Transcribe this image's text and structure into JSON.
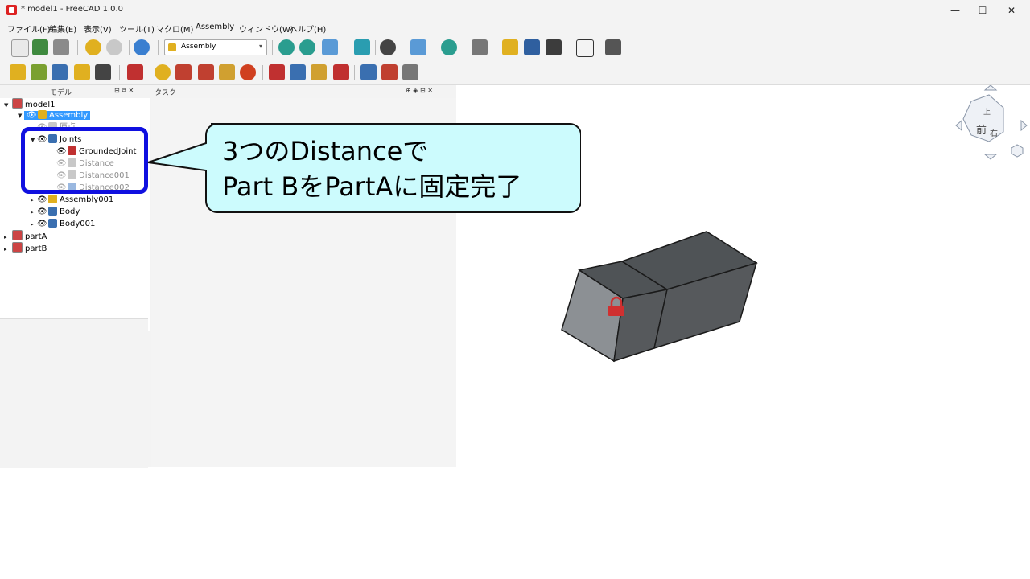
{
  "window": {
    "title": "* model1 - FreeCAD 1.0.0",
    "minimize": "—",
    "maximize": "☐",
    "close": "✕"
  },
  "menu": [
    "ファイル(F)",
    "編集(E)",
    "表示(V)",
    "ツール(T)",
    "マクロ(M)",
    "Assembly",
    "ウィンドウ(W)",
    "ヘルプ(H)"
  ],
  "toolbar": {
    "workbench": "Assembly",
    "dropdown_arrow": "▾"
  },
  "panels": {
    "model_title": "モデル",
    "task_title": "タスク",
    "controls": "⊟ ⧉ ✕",
    "task_controls": "⊕ ◈ ⊟ ✕"
  },
  "tree": {
    "model1": "model1",
    "assembly": "Assembly",
    "origin": "原点",
    "joints": "Joints",
    "grounded": "GroundedJoint",
    "distance": "Distance",
    "distance001": "Distance001",
    "distance002": "Distance002",
    "assembly001": "Assembly001",
    "body": "Body",
    "body001": "Body001",
    "partA": "partA",
    "partB": "partB"
  },
  "navcube": {
    "front": "前",
    "right": "右",
    "top": "上"
  },
  "callout": {
    "line1": "3つのDistanceで",
    "line2": "Part BをPartAに固定完了"
  },
  "colors": {
    "highlight": "#1010e0",
    "callout_fill": "#ccfbfd",
    "selection": "#3399ff",
    "lock": "#d03030"
  }
}
